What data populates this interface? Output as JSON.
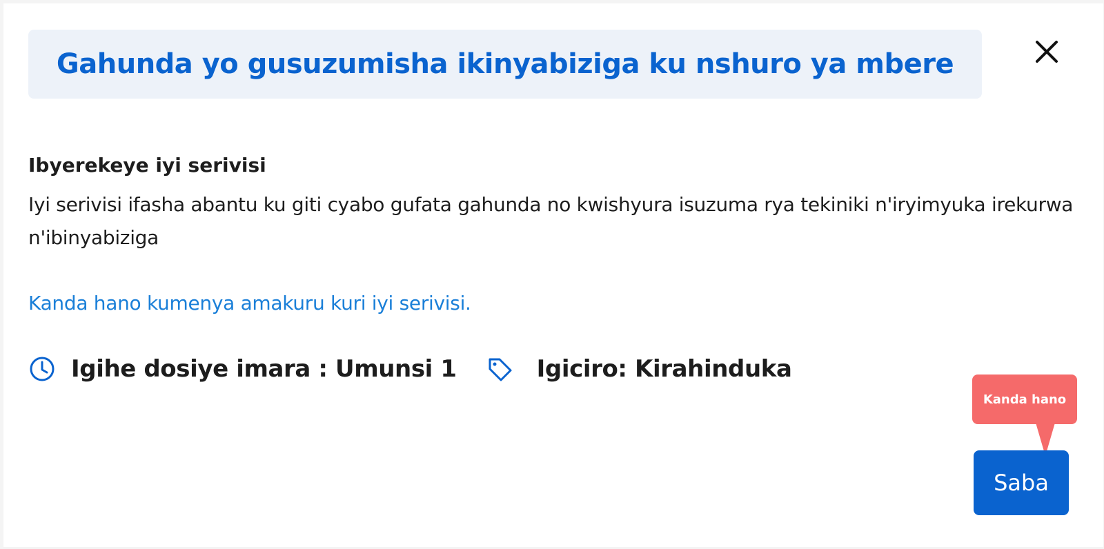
{
  "dialog": {
    "title": "Gahunda yo gusuzumisha ikinyabiziga ku nshuro ya mbere",
    "close_icon": "close-icon"
  },
  "about": {
    "heading": "Ibyerekeye iyi serivisi",
    "text": "Iyi serivisi ifasha abantu ku giti cyabo gufata gahunda no kwishyura isuzuma rya tekiniki n'iryimyuka irekurwa n'ibinyabiziga"
  },
  "link": {
    "label": "Kanda hano kumenya amakuru kuri iyi serivisi."
  },
  "meta": {
    "time_icon": "clock-icon",
    "time_label": "Igihe dosiye imara : Umunsi 1",
    "price_icon": "tag-icon",
    "price_label": "Igiciro: Kirahinduka"
  },
  "tooltip": {
    "label": "Kanda hano"
  },
  "actions": {
    "apply_label": "Saba"
  },
  "colors": {
    "primary": "#0a63cf",
    "link": "#1a7fd8",
    "title_bg": "#edf2f9",
    "tooltip_bg": "#f56a6a"
  }
}
